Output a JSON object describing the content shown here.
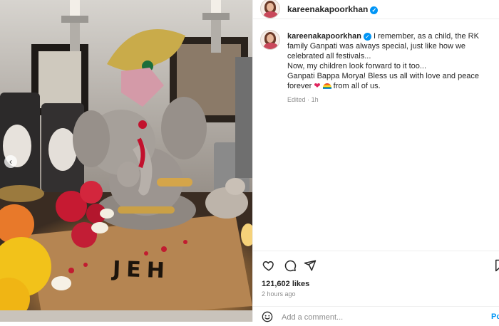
{
  "post": {
    "username": "kareenakapoorkhan",
    "verified_icon": "verified-badge-icon",
    "caption": {
      "line1": "I remember, as a child, the RK family Ganpati was always special, just like how we celebrated all festivals...",
      "line2": "Now, my children look forward to it too...",
      "line3_part1": "Ganpati Bappa Morya! Bless us all with love and peace forever",
      "line3_part2": "from all of us."
    },
    "edited_label": "Edited",
    "edited_separator": "·",
    "edited_time": "1h",
    "likes": "121,602 likes",
    "posted_time": "2 hours ago"
  },
  "photo": {
    "carousel_prev_icon": "chevron-left-icon",
    "handwritten_text": "JEH"
  },
  "actions": {
    "like_icon": "heart-icon",
    "comment_icon": "comment-icon",
    "share_icon": "send-icon",
    "save_icon": "bookmark-icon"
  },
  "comment_box": {
    "placeholder": "Add a comment...",
    "post_label": "Post",
    "emoji_icon": "emoji-icon"
  },
  "colors": {
    "accent": "#0095f6",
    "heart": "#e0245e",
    "muted": "#8e8e8e"
  }
}
